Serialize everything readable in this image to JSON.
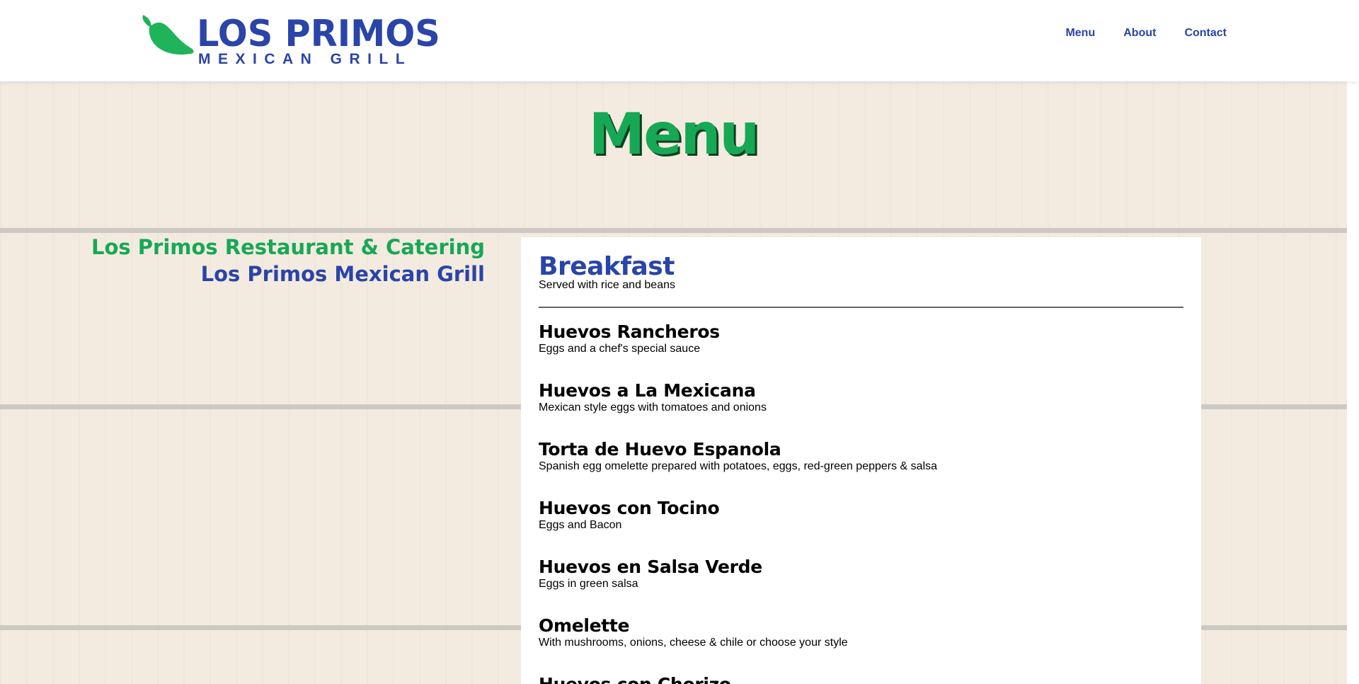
{
  "header": {
    "logo_title": "LOS PRIMOS",
    "logo_subtitle": "MEXICAN GRILL",
    "nav": [
      {
        "label": "Menu"
      },
      {
        "label": "About"
      },
      {
        "label": "Contact"
      }
    ]
  },
  "colors": {
    "brand_blue": "#2a44a8",
    "brand_green": "#17a855"
  },
  "page_title": "Menu",
  "sidebar_titles": {
    "line1": "Los Primos Restaurant & Catering",
    "line2": "Los Primos Mexican Grill"
  },
  "section": {
    "title": "Breakfast",
    "subtitle": "Served with rice and beans",
    "items": [
      {
        "name": "Huevos Rancheros",
        "description": "Eggs and a chef's special sauce"
      },
      {
        "name": "Huevos a La Mexicana",
        "description": "Mexican style eggs with tomatoes and onions"
      },
      {
        "name": "Torta de Huevo Espanola",
        "description": "Spanish egg omelette prepared with potatoes, eggs, red-green peppers & salsa"
      },
      {
        "name": "Huevos con Tocino",
        "description": "Eggs and Bacon"
      },
      {
        "name": "Huevos en Salsa Verde",
        "description": "Eggs in green salsa"
      },
      {
        "name": "Omelette",
        "description": "With mushrooms, onions, cheese & chile or choose your style"
      },
      {
        "name": "Huevos con Chorizo",
        "description": ""
      }
    ]
  }
}
